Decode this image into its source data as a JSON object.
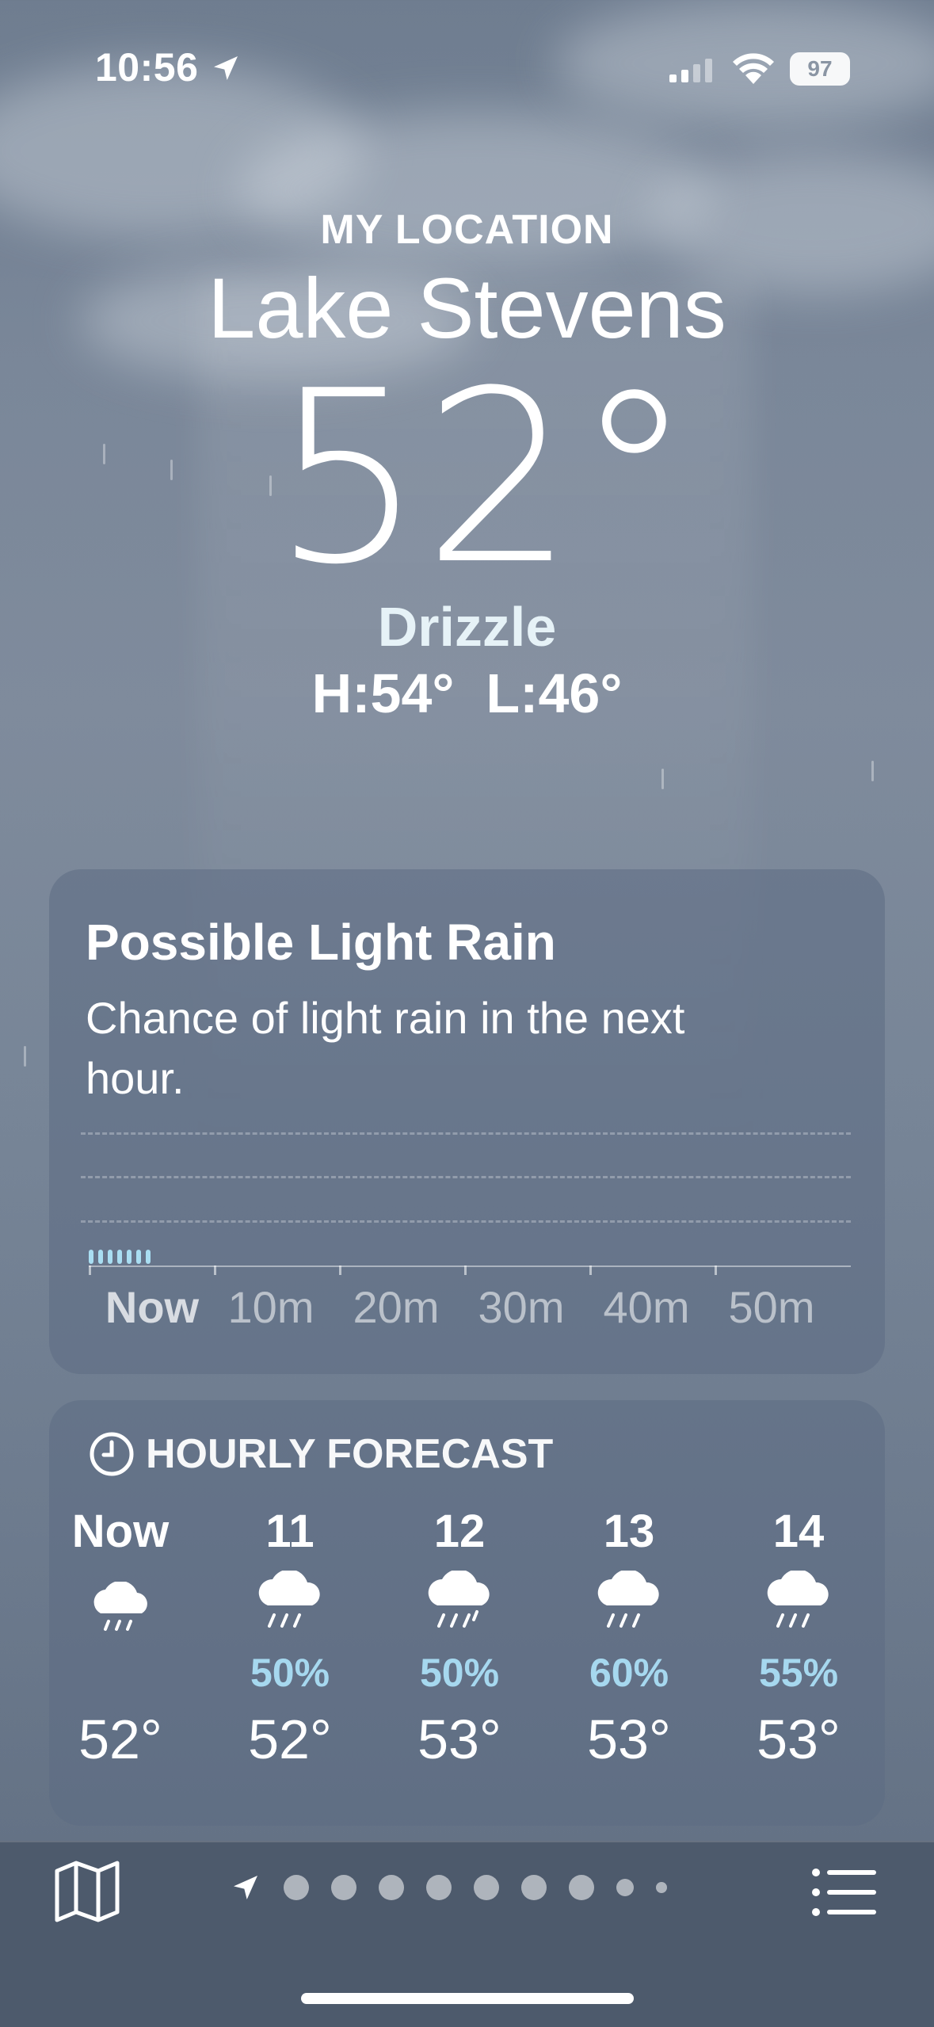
{
  "status_bar": {
    "time": "10:56",
    "battery": "97"
  },
  "header": {
    "label": "MY LOCATION",
    "city": "Lake Stevens",
    "temperature": "52°",
    "condition": "Drizzle",
    "high": "H:54°",
    "low": "L:46°"
  },
  "precip_card": {
    "title": "Possible Light Rain",
    "description": "Chance of light rain in the next hour.",
    "time_labels": [
      "Now",
      "10m",
      "20m",
      "30m",
      "40m",
      "50m"
    ]
  },
  "hourly_card": {
    "title": "HOURLY FORECAST",
    "hours": [
      {
        "label": "Now",
        "icon": "drizzle-icon",
        "pop": "",
        "temp": "52°"
      },
      {
        "label": "11",
        "icon": "rain-icon",
        "pop": "50%",
        "temp": "52°"
      },
      {
        "label": "12",
        "icon": "rain-icon",
        "pop": "50%",
        "temp": "53°"
      },
      {
        "label": "13",
        "icon": "rain-icon",
        "pop": "60%",
        "temp": "53°"
      },
      {
        "label": "14",
        "icon": "rain-icon",
        "pop": "55%",
        "temp": "53°"
      }
    ]
  },
  "bottom_bar": {
    "page_count": 9,
    "current_page": "location"
  },
  "colors": {
    "precip_accent": "#a9def2",
    "pop_text": "#a6d8ef",
    "card_bg": "#5c6c84",
    "bar_bg": "#4d5a6c"
  }
}
